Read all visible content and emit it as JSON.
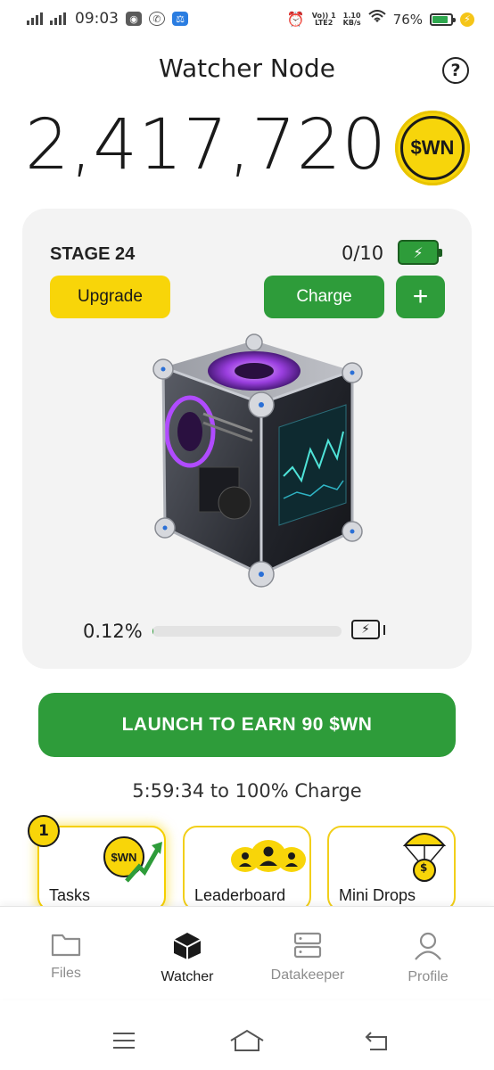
{
  "status_bar": {
    "time": "09:03",
    "network_top": "Vo)) 1",
    "network_bottom": "LTE2",
    "speed_top": "1.10",
    "speed_bottom": "KB/s",
    "battery_percent": "76%",
    "battery_level": 0.76
  },
  "header": {
    "title": "Watcher Node",
    "help_label": "?"
  },
  "balance": {
    "amount": "2,417,720",
    "token": "$WN"
  },
  "node_card": {
    "stage": "STAGE 24",
    "charge_count": "0/10",
    "upgrade_label": "Upgrade",
    "charge_label": "Charge",
    "add_label": "+",
    "progress_text": "0.12%",
    "progress_value": 0.12
  },
  "launch": {
    "label": "LAUNCH TO EARN 90 $WN",
    "timer_text": "5:59:34 to 100% Charge"
  },
  "tiles": {
    "tasks": {
      "label": "Tasks",
      "badge": "1",
      "coin": "$WN"
    },
    "leaderboard": {
      "label": "Leaderboard"
    },
    "mini_drops": {
      "label": "Mini Drops",
      "coin": "$"
    }
  },
  "bottom_nav": {
    "files": "Files",
    "watcher": "Watcher",
    "datakeeper": "Datakeeper",
    "profile": "Profile"
  },
  "colors": {
    "accent_green": "#2e9c3a",
    "accent_yellow": "#f8d509",
    "card_bg": "#f3f3f3"
  }
}
